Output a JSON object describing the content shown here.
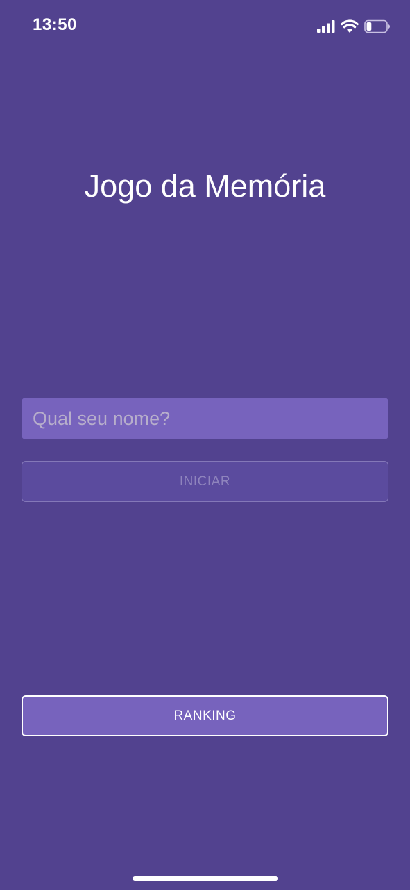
{
  "status_bar": {
    "time": "13:50",
    "icons": [
      "signal-icon",
      "wifi-icon",
      "battery-icon"
    ],
    "battery_level": 0.25
  },
  "screen": {
    "title": "Jogo da Memória",
    "name_input": {
      "placeholder": "Qual seu nome?",
      "value": ""
    },
    "start_button_label": "INICIAR",
    "start_button_enabled": false,
    "ranking_button_label": "RANKING"
  },
  "colors": {
    "background": "#52428f",
    "input_background": "#7763bd",
    "disabled_button_text": "#8f84bd",
    "primary_text": "#ffffff"
  }
}
